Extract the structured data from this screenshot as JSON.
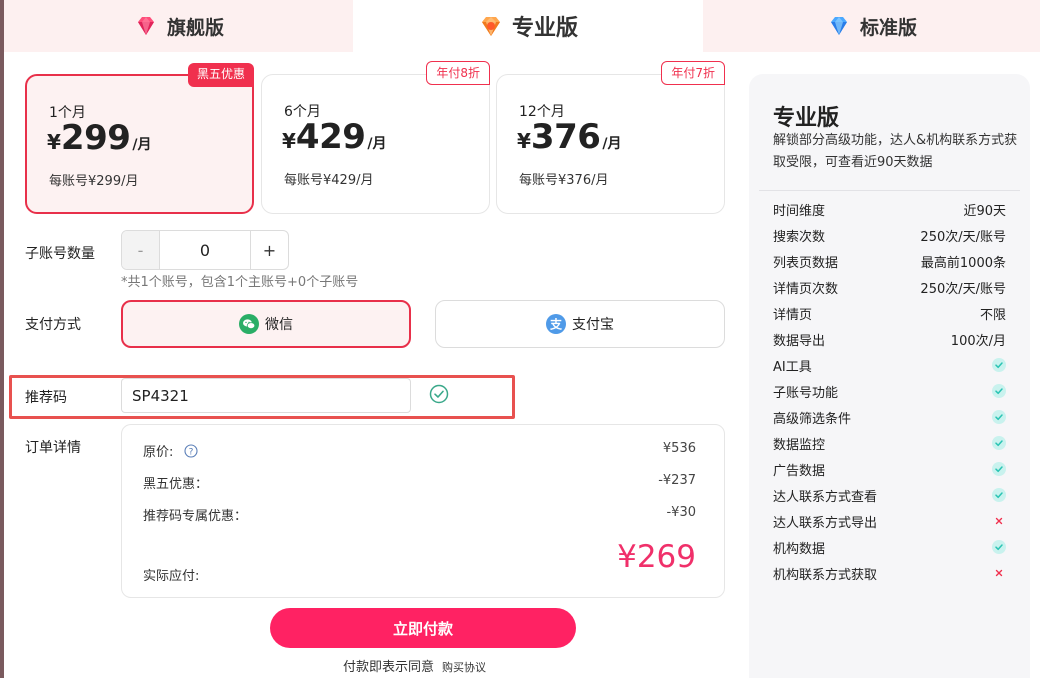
{
  "tabs": [
    {
      "label": "旗舰版",
      "active": false
    },
    {
      "label": "专业版",
      "active": true
    },
    {
      "label": "标准版",
      "active": false
    }
  ],
  "plans": [
    {
      "period": "1个月",
      "currency": "¥",
      "price": "299",
      "unit": "/月",
      "per_account": "每账号¥299/月",
      "badge": "黑五优惠",
      "selected": true
    },
    {
      "period": "6个月",
      "currency": "¥",
      "price": "429",
      "unit": "/月",
      "per_account": "每账号¥429/月",
      "badge": "年付8折",
      "selected": false
    },
    {
      "period": "12个月",
      "currency": "¥",
      "price": "376",
      "unit": "/月",
      "per_account": "每账号¥376/月",
      "badge": "年付7折",
      "selected": false
    }
  ],
  "sub_accounts": {
    "label": "子账号数量",
    "minus": "-",
    "value": "0",
    "plus": "+",
    "note": "*共1个账号，包含1个主账号+0个子账号"
  },
  "payment": {
    "label": "支付方式",
    "wechat": "微信",
    "alipay": "支付宝",
    "selected": "wechat"
  },
  "referral": {
    "label": "推荐码",
    "value": "SP4321"
  },
  "order": {
    "label": "订单详情",
    "original_label": "原价:",
    "original_value": "¥536",
    "black_friday_label": "黑五优惠：",
    "black_friday_value": "-¥237",
    "referral_label": "推荐码专属优惠：",
    "referral_value": "-¥30",
    "total_label": "实际应付:",
    "total_value": "¥269"
  },
  "actions": {
    "pay_now": "立即付款",
    "agree_text": "付款即表示同意",
    "agreement_link": "购买协议"
  },
  "side": {
    "title": "专业版",
    "description": "解锁部分高级功能，达人&机构联系方式获取受限，可查看近90天数据",
    "features": [
      {
        "name": "时间维度",
        "value": "近90天"
      },
      {
        "name": "搜索次数",
        "value": "250次/天/账号"
      },
      {
        "name": "列表页数据",
        "value": "最高前1000条"
      },
      {
        "name": "详情页次数",
        "value": "250次/天/账号"
      },
      {
        "name": "详情页",
        "value": "不限"
      },
      {
        "name": "数据导出",
        "value": "100次/月"
      },
      {
        "name": "AI工具",
        "icon": "check-icon"
      },
      {
        "name": "子账号功能",
        "icon": "check-icon"
      },
      {
        "name": "高级筛选条件",
        "icon": "check-icon"
      },
      {
        "name": "数据监控",
        "icon": "check-icon"
      },
      {
        "name": "广告数据",
        "icon": "check-icon"
      },
      {
        "name": "达人联系方式查看",
        "icon": "check-icon"
      },
      {
        "name": "达人联系方式导出",
        "icon": "cross-icon"
      },
      {
        "name": "机构数据",
        "icon": "check-icon"
      },
      {
        "name": "机构联系方式获取",
        "icon": "cross-icon"
      }
    ]
  },
  "colors": {
    "accent": "#e8304a",
    "pay_button": "#ff2263",
    "total": "#f0306a",
    "check": "#3cd6c8"
  }
}
